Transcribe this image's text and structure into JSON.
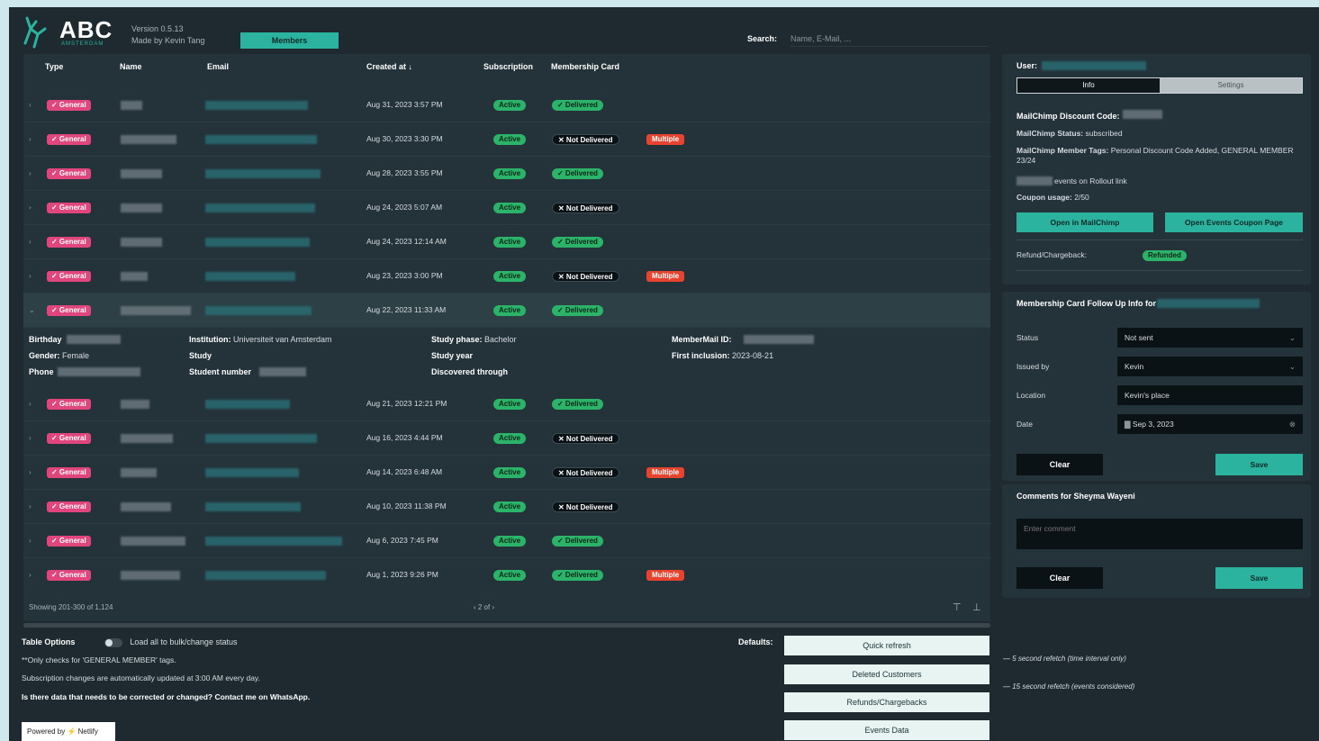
{
  "header": {
    "brand": "ABC",
    "brand_sub": "AMSTERDAM",
    "version": "Version 0.5.13",
    "made_by": "Made by Kevin Tang",
    "nav_button": "Members",
    "search_label": "Search:",
    "search_placeholder": "Name, E-Mail, ..."
  },
  "table": {
    "columns": [
      "Type",
      "Name",
      "Email",
      "Created at ↓",
      "Subscription",
      "Membership Card"
    ],
    "rows": [
      {
        "type": "✓ General",
        "date": "Aug 31, 2023 3:57 PM",
        "subscription": "Active",
        "card": "✓ Delivered",
        "multiple": ""
      },
      {
        "type": "✓ General",
        "date": "Aug 30, 2023 3:30 PM",
        "subscription": "Active",
        "card": "✕ Not Delivered",
        "multiple": "Multiple"
      },
      {
        "type": "✓ General",
        "date": "Aug 28, 2023 3:55 PM",
        "subscription": "Active",
        "card": "✓ Delivered",
        "multiple": ""
      },
      {
        "type": "✓ General",
        "date": "Aug 24, 2023 5:07 AM",
        "subscription": "Active",
        "card": "✕ Not Delivered",
        "multiple": ""
      },
      {
        "type": "✓ General",
        "date": "Aug 24, 2023 12:14 AM",
        "subscription": "Active",
        "card": "✓ Delivered",
        "multiple": ""
      },
      {
        "type": "✓ General",
        "date": "Aug 23, 2023 3:00 PM",
        "subscription": "Active",
        "card": "✕ Not Delivered",
        "multiple": "Multiple"
      },
      {
        "type": "✓ General",
        "date": "Aug 22, 2023 11:33 AM",
        "subscription": "Active",
        "card": "✓ Delivered",
        "multiple": ""
      },
      {
        "type": "✓ General",
        "date": "Aug 21, 2023 12:21 PM",
        "subscription": "Active",
        "card": "✓ Delivered",
        "multiple": ""
      },
      {
        "type": "✓ General",
        "date": "Aug 16, 2023 4:44 PM",
        "subscription": "Active",
        "card": "✕ Not Delivered",
        "multiple": ""
      },
      {
        "type": "✓ General",
        "date": "Aug 14, 2023 6:48 AM",
        "subscription": "Active",
        "card": "✕ Not Delivered",
        "multiple": "Multiple"
      },
      {
        "type": "✓ General",
        "date": "Aug 10, 2023 11:38 PM",
        "subscription": "Active",
        "card": "✕ Not Delivered",
        "multiple": ""
      },
      {
        "type": "✓ General",
        "date": "Aug 6, 2023 7:45 PM",
        "subscription": "Active",
        "card": "✓ Delivered",
        "multiple": ""
      },
      {
        "type": "✓ General",
        "date": "Aug 1, 2023 9:26 PM",
        "subscription": "Active",
        "card": "✓ Delivered",
        "multiple": "Multiple"
      }
    ],
    "expanded": {
      "birthday_label": "Birthday",
      "gender_label": "Gender:",
      "gender_value": "Female",
      "phone_label": "Phone",
      "institution_label": "Institution:",
      "institution_value": "Universiteit van Amsterdam",
      "study_label": "Study",
      "student_number_label": "Student number",
      "study_phase_label": "Study phase:",
      "study_phase_value": "Bachelor",
      "study_year_label": "Study year",
      "discovered_label": "Discovered through",
      "mailchimp_id_label": "MemberMail ID:",
      "first_inclusion_label": "First inclusion:",
      "first_inclusion_value": "2023-08-21"
    },
    "footer_showing": "Showing 201-300 of 1,124",
    "pager": "‹   2   of   ›"
  },
  "options": {
    "title": "Table Options",
    "toggle_label": "Load all to bulk/change status",
    "note1": "**Only checks for 'GENERAL MEMBER' tags.",
    "note2": "Subscription changes are automatically updated at 3:00 AM every day.",
    "note3": "Is there data that needs to be corrected or changed? Contact me on WhatsApp.",
    "powered": "Powered by ⚡ Netlify"
  },
  "defaults": {
    "label": "Defaults:",
    "buttons": [
      "Quick refresh",
      "Deleted Customers",
      "Refunds/Chargebacks",
      "Events Data"
    ],
    "note1": "— 5 second refetch (time interval only)",
    "note2": "— 15 second refetch (events considered)"
  },
  "user_panel": {
    "user_label": "User:",
    "tab_info": "Info",
    "tab_settings": "Settings",
    "discount_code_label": "MailChimp Discount Code:",
    "status_label": "MailChimp Status:",
    "status_value": "subscribed",
    "tags_label": "MailChimp Member Tags:",
    "tags_value": "Personal Discount Code Added, GENERAL MEMBER 23/24",
    "events_value": "events on Rollout link",
    "coupon_label": "Coupon usage:",
    "coupon_value": "2/50",
    "btn_open_mailchimp": "Open in MailChimp",
    "btn_open_coupon": "Open Events Coupon Page",
    "refund_label": "Refund/Chargeback:",
    "refund_value": "Refunded"
  },
  "followup_panel": {
    "title": "Membership Card Follow Up Info for",
    "status_label": "Status",
    "status_value": "Not sent",
    "issued_label": "Issued by",
    "issued_value": "Kevin",
    "location_label": "Location",
    "location_value": "Kevin's place",
    "date_label": "Date",
    "date_value": "Sep 3, 2023",
    "clear": "Clear",
    "save": "Save"
  },
  "comments_panel": {
    "title": "Comments for Sheyma Wayeni",
    "placeholder": "Enter comment",
    "clear": "Clear",
    "save": "Save"
  }
}
